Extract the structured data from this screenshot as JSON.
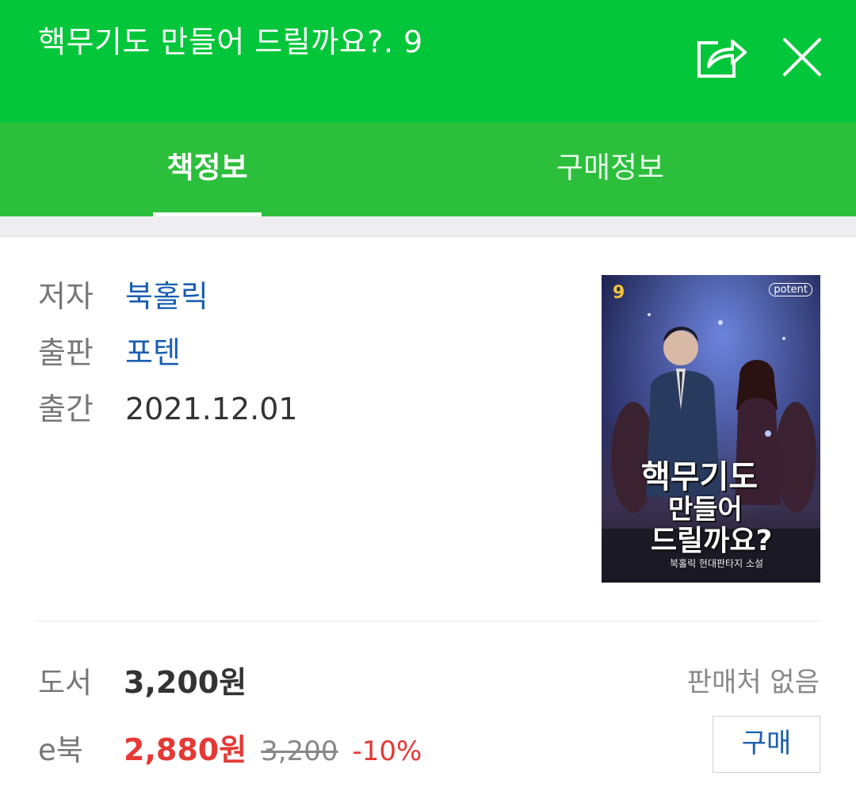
{
  "header": {
    "title": "핵무기도 만들어 드릴까요?. 9",
    "share_icon": "share-icon",
    "close_icon": "close-icon"
  },
  "tabs": [
    {
      "label": "책정보",
      "active": true
    },
    {
      "label": "구매정보",
      "active": false
    }
  ],
  "info": {
    "author_label": "저자",
    "author": "북홀릭",
    "publisher_label": "출판",
    "publisher": "포텐",
    "date_label": "출간",
    "date": "2021.12.01"
  },
  "cover": {
    "volume": "9",
    "publisher_logo": "potent",
    "title_lines": [
      "핵무기도",
      "만들어",
      "드릴까요?"
    ],
    "author_line": "북홀릭 현대판타지 소설"
  },
  "prices": {
    "book_label": "도서",
    "book_price": "3,200원",
    "no_seller": "판매처 없음",
    "ebook_label": "e북",
    "ebook_price": "2,880원",
    "ebook_original": "3,200",
    "ebook_discount": "-10%",
    "buy_label": "구매"
  },
  "colors": {
    "header_green": "#03c63a",
    "tab_green": "#2cbf3b",
    "link_blue": "#1b5fb0",
    "sale_red": "#e53935"
  }
}
